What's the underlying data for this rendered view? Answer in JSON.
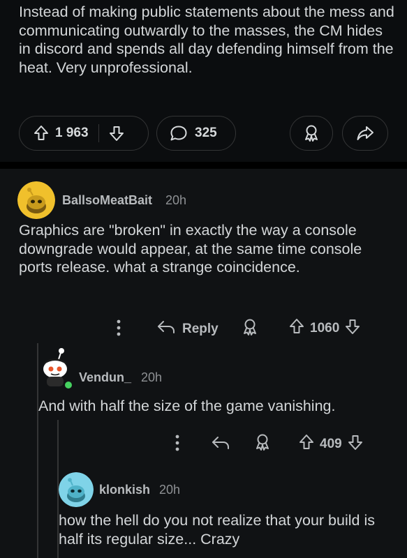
{
  "post": {
    "body": "Instead of making public statements about the mess and communicating outwardly to the masses, the CM hides in discord and spends all day defending himself from the heat. Very unprofessional.",
    "vote_count": "1 963",
    "comment_count": "325"
  },
  "comments": [
    {
      "username": "BallsoMeatBait",
      "time": "20h",
      "text": "Graphics are \"broken\" in exactly the way a console downgrade would appear, at the same time console ports release. what a strange coincidence.",
      "reply_label": "Reply",
      "score": "1060",
      "avatar_color": "#f0c02c"
    },
    {
      "username": "Vendun_",
      "time": "20h",
      "text": "And with half the size of the game vanishing.",
      "score": "409",
      "online_color": "#46d160"
    },
    {
      "username": "klonkish",
      "time": "20h",
      "text": "how the hell do you not realize that your build is half its regular size... Crazy",
      "avatar_color": "#7fd3e8"
    }
  ],
  "icons": {
    "upvote": "arrow-up-outline",
    "downvote": "arrow-down-outline",
    "comment": "speech-bubble",
    "award": "award-ribbon",
    "share": "share-arrow",
    "more": "vertical-dots",
    "reply": "reply-arrow"
  },
  "colors": {
    "background": "#0b0d0f",
    "comment_background": "#101214",
    "text": "#d7dadc",
    "muted": "#8e9194",
    "border": "#343536"
  }
}
